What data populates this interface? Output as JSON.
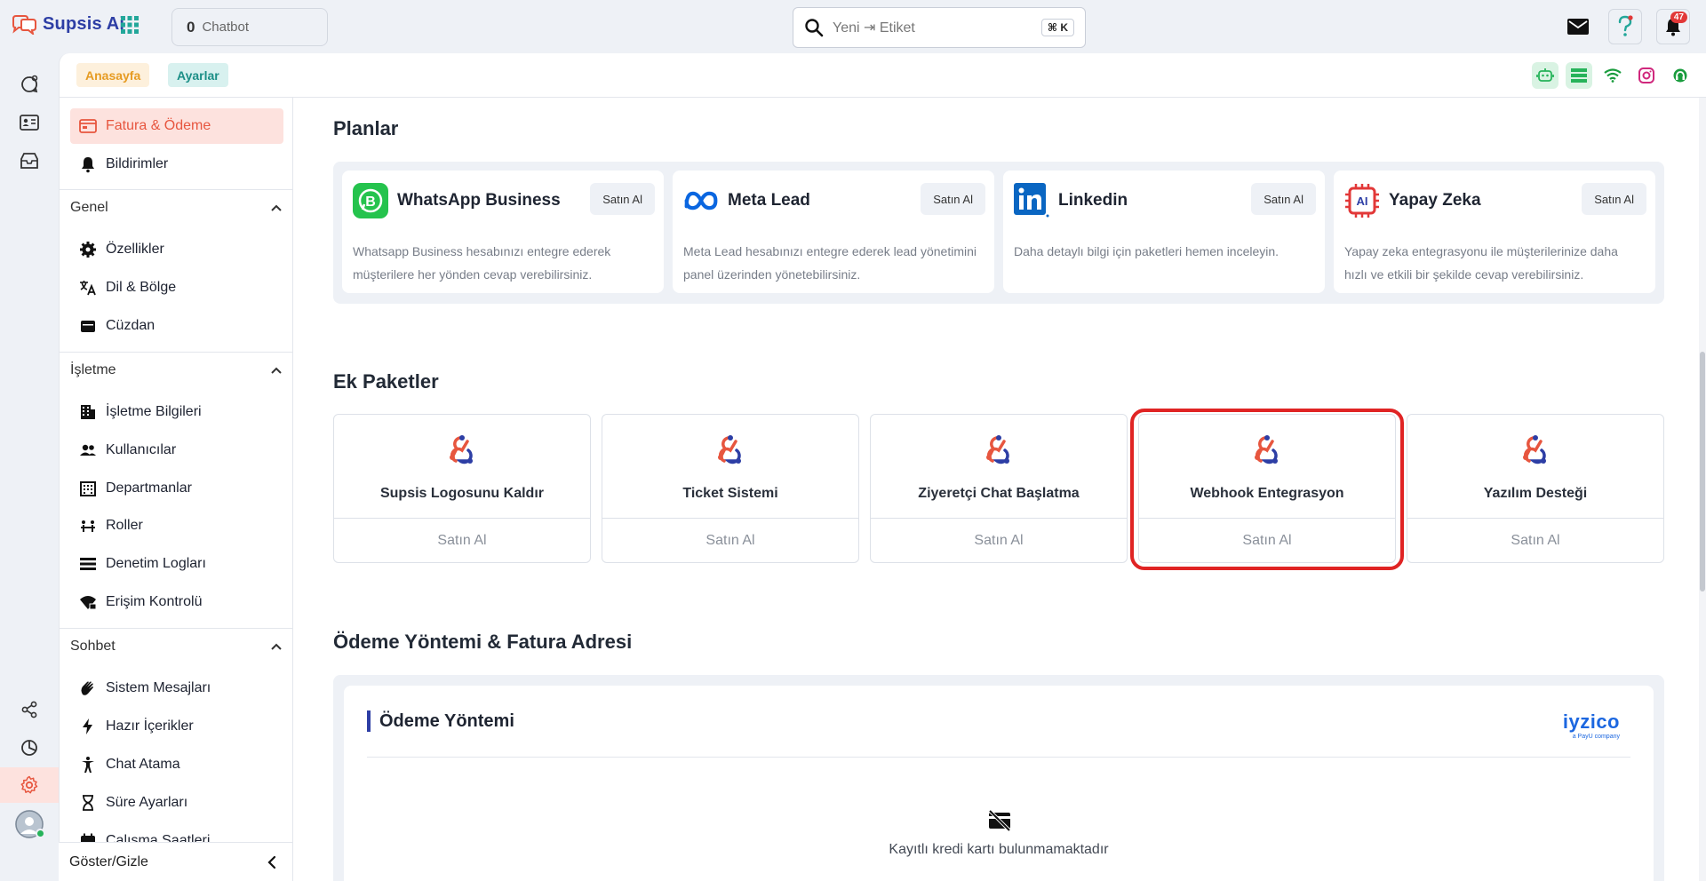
{
  "brand": {
    "name": "Supsis Ai"
  },
  "chatbot": {
    "count": "0",
    "label": "Chatbot"
  },
  "search": {
    "placeholder": "Yeni ⇥ Etiket",
    "shortcut": "⌘ K"
  },
  "notifications": {
    "count": "47"
  },
  "breadcrumbs": {
    "home": "Anasayfa",
    "settings": "Ayarlar"
  },
  "menu": {
    "top": [
      {
        "label": "Fatura & Ödeme",
        "icon": "invoice-icon"
      },
      {
        "label": "Bildirimler",
        "icon": "bell-icon"
      }
    ],
    "sections": {
      "genel": {
        "title": "Genel",
        "items": [
          "Özellikler",
          "Dil & Bölge",
          "Cüzdan"
        ]
      },
      "isletme": {
        "title": "İşletme",
        "items": [
          "İşletme Bilgileri",
          "Kullanıcılar",
          "Departmanlar",
          "Roller",
          "Denetim Logları",
          "Erişim Kontrolü"
        ]
      },
      "sohbet": {
        "title": "Sohbet",
        "items": [
          "Sistem Mesajları",
          "Hazır İçerikler",
          "Chat Atama",
          "Süre Ayarları",
          "Çalışma Saatleri"
        ]
      }
    },
    "footer": "Göster/Gizle"
  },
  "plans": {
    "title": "Planlar",
    "items": [
      {
        "title": "WhatsApp Business",
        "buy": "Satın Al",
        "desc": "Whatsapp Business hesabınızı entegre ederek müşterilere her yönden cevap verebilirsiniz."
      },
      {
        "title": "Meta Lead",
        "buy": "Satın Al",
        "desc": "Meta Lead hesabınızı entegre ederek lead yönetimini panel üzerinden yönetebilirsiniz."
      },
      {
        "title": "Linkedin",
        "buy": "Satın Al",
        "desc": "Daha detaylı bilgi için paketleri hemen inceleyin."
      },
      {
        "title": "Yapay Zeka",
        "buy": "Satın Al",
        "desc": "Yapay zeka entegrasyonu ile müşterilerinize daha hızlı ve etkili bir şekilde cevap verebilirsiniz."
      }
    ]
  },
  "packages": {
    "title": "Ek Paketler",
    "items": [
      {
        "title": "Supsis Logosunu Kaldır",
        "buy": "Satın Al"
      },
      {
        "title": "Ticket Sistemi",
        "buy": "Satın Al"
      },
      {
        "title": "Ziyeretçi Chat Başlatma",
        "buy": "Satın Al"
      },
      {
        "title": "Webhook Entegrasyon",
        "buy": "Satın Al"
      },
      {
        "title": "Yazılım Desteği",
        "buy": "Satın Al"
      }
    ]
  },
  "payment": {
    "title": "Ödeme Yöntemi & Fatura Adresi",
    "card_title": "Ödeme Yöntemi",
    "provider": "iyzico",
    "provider_sub": "a PayU company",
    "empty": "Kayıtlı kredi kartı bulunmamaktadır"
  },
  "colors": {
    "accent": "#e7563f",
    "brand": "#2d3ea5",
    "highlight": "#e02424"
  }
}
